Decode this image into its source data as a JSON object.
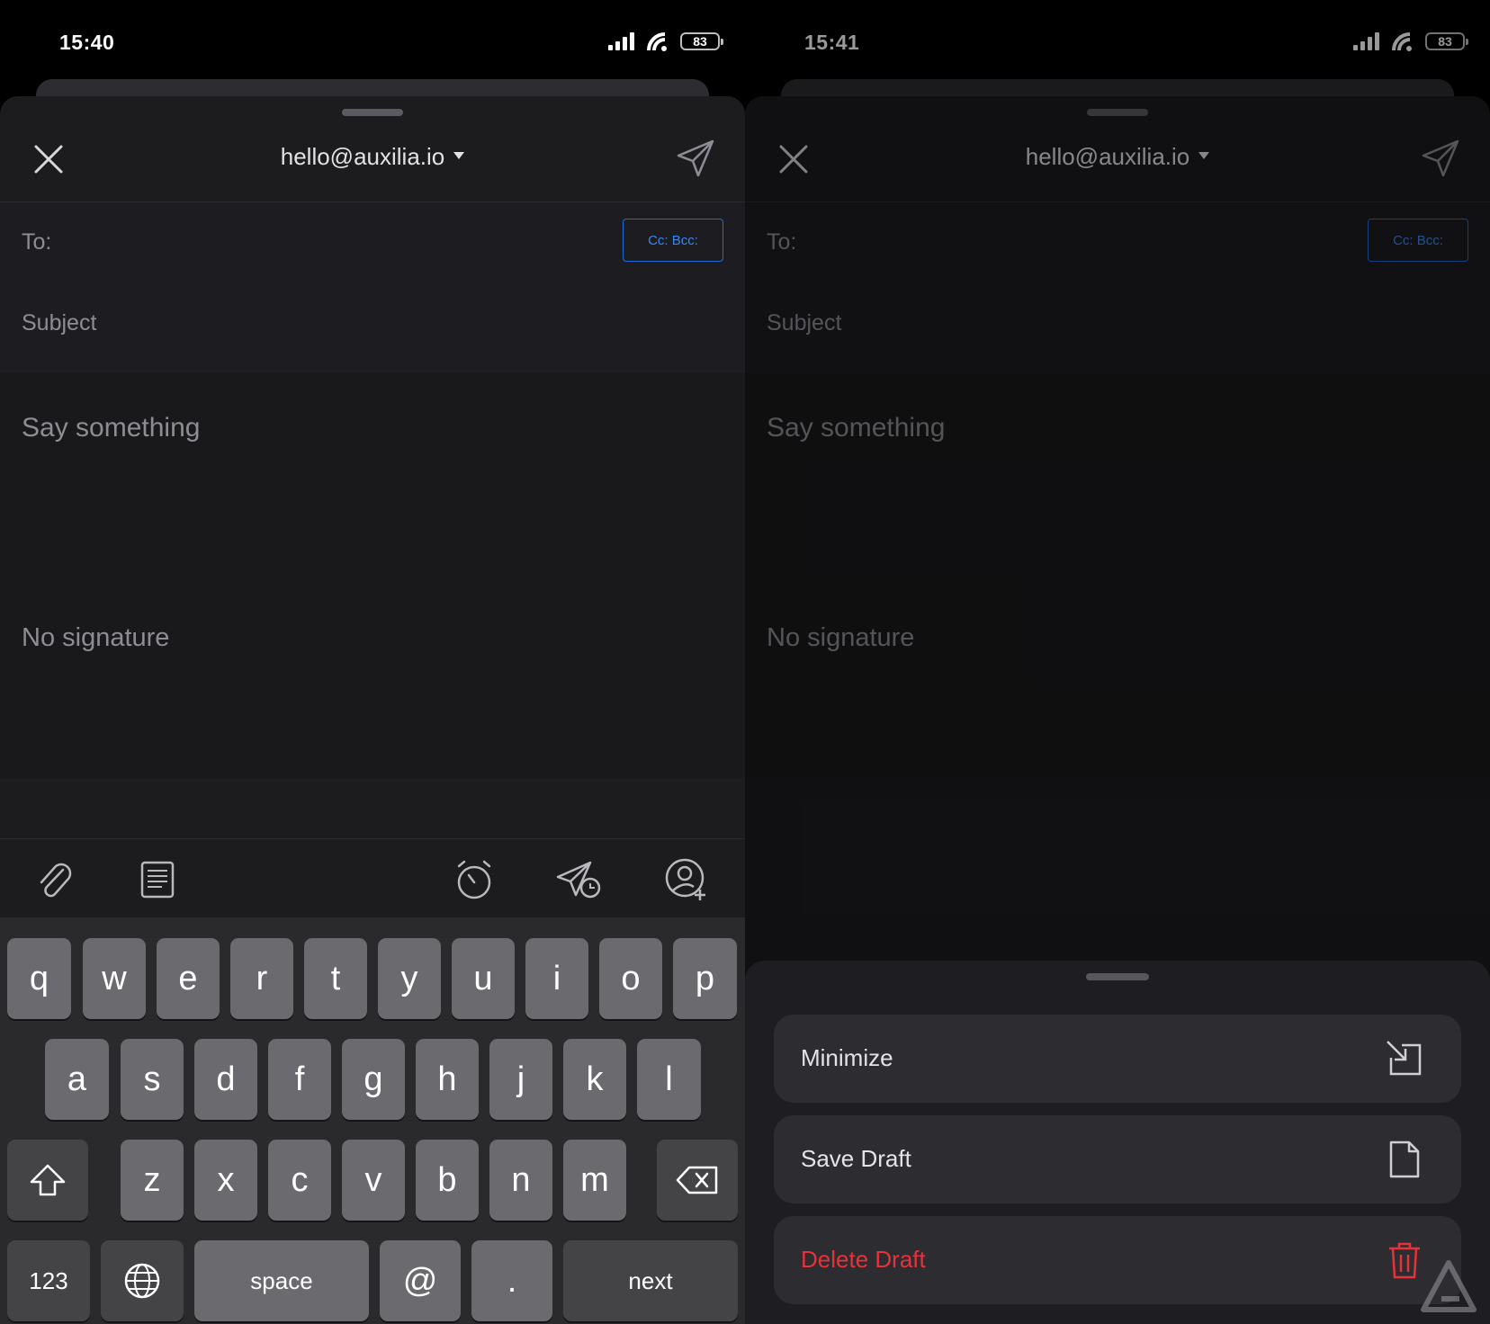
{
  "left_screen": {
    "status": {
      "time": "15:40",
      "battery": "83"
    },
    "header": {
      "from_address": "hello@auxilia.io"
    },
    "fields": {
      "to_label": "To:",
      "cc_bcc_label": "Cc: Bcc:",
      "subject_placeholder": "Subject"
    },
    "body": {
      "placeholder": "Say something",
      "signature": "No signature"
    },
    "toolbar": {
      "icons": [
        "paperclip-icon",
        "template-icon",
        "alarm-clock-icon",
        "schedule-send-icon",
        "add-contact-icon"
      ]
    },
    "keyboard": {
      "row1": [
        "q",
        "w",
        "e",
        "r",
        "t",
        "y",
        "u",
        "i",
        "o",
        "p"
      ],
      "row2": [
        "a",
        "s",
        "d",
        "f",
        "g",
        "h",
        "j",
        "k",
        "l"
      ],
      "row3": [
        "z",
        "x",
        "c",
        "v",
        "b",
        "n",
        "m"
      ],
      "numbers_label": "123",
      "space_label": "space",
      "at_label": "@",
      "dot_label": ".",
      "next_label": "next"
    }
  },
  "right_screen": {
    "status": {
      "time": "15:41",
      "battery": "83"
    },
    "header": {
      "from_address": "hello@auxilia.io"
    },
    "fields": {
      "to_label": "To:",
      "cc_bcc_label": "Cc: Bcc:",
      "subject_placeholder": "Subject"
    },
    "body": {
      "placeholder": "Say something",
      "signature": "No signature"
    },
    "action_sheet": {
      "minimize_label": "Minimize",
      "save_draft_label": "Save Draft",
      "delete_draft_label": "Delete Draft"
    }
  },
  "colors": {
    "accent_blue": "#1e6bd6",
    "danger_red": "#e8323a",
    "sheet_bg": "#1c1c1f",
    "key_bg": "#6b6b6f"
  }
}
